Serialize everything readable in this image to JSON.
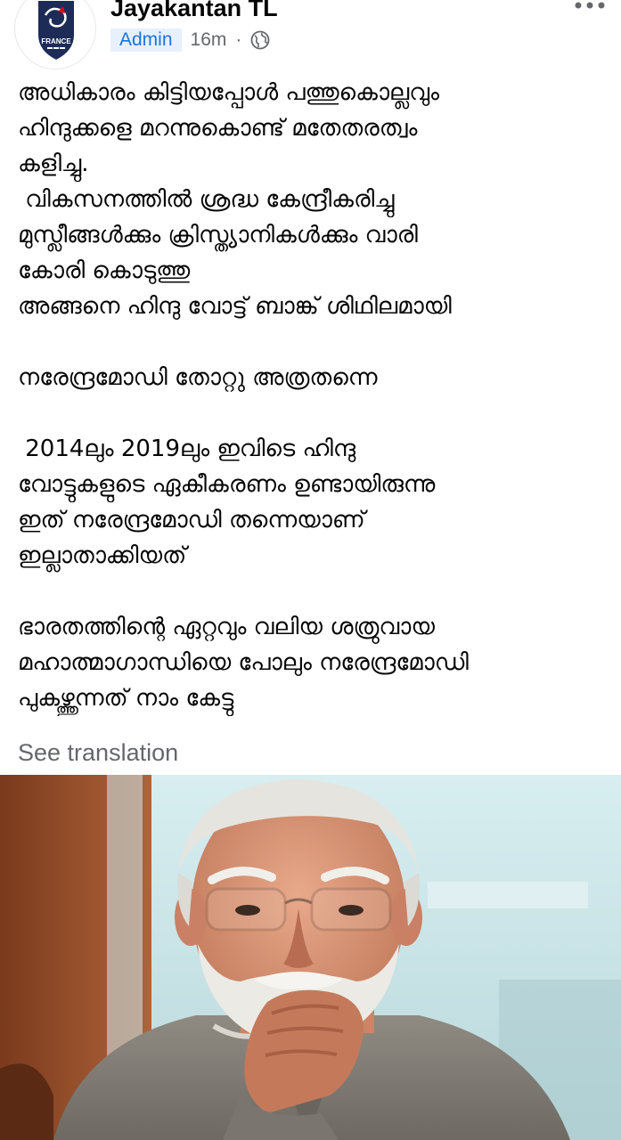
{
  "post": {
    "author_name": "Jayakantan TL",
    "badge": "Admin",
    "time": "16m",
    "separator": "·",
    "privacy_icon": "globe-icon",
    "avatar_logo_text": "FRANCE",
    "text_lines": [
      "അധികാരം കിട്ടിയപ്പോൾ പത്തുകൊല്ലവും",
      "ഹിന്ദുക്കളെ മറന്നുകൊണ്ട് മതേതരത്വം",
      "കളിച്ചു.",
      " വികസനത്തിൽ ശ്രദ്ധ കേന്ദ്രീകരിച്ചു",
      "മുസ്ലീങ്ങൾക്കും ക്രിസ്ത്യാനികൾക്കും വാരി",
      "കോരി കൊടുത്തു",
      "അങ്ങനെ ഹിന്ദു വോട്ട് ബാങ്ക് ശിഥിലമായി",
      "",
      "നരേന്ദ്രമോഡി തോറ്റു അത്രതന്നെ",
      "",
      " 2014ലും 2019ലും ഇവിടെ ഹിന്ദു",
      "വോട്ടുകളുടെ ഏകീകരണം ഉണ്ടായിരുന്നു",
      "ഇത് നരേന്ദ്രമോഡി തന്നെയാണ്",
      "ഇല്ലാതാക്കിയത്",
      "",
      "ഭാരതത്തിന്റെ ഏറ്റവും വലിയ ശത്രുവായ",
      "മഹാത്മാഗാന്ധിയെ പോലും നരേന്ദ്രമോഡി",
      "പുകഴ്ത്തുന്നത് നാം കേട്ടു"
    ],
    "see_translation": "See translation"
  },
  "colors": {
    "badge_text": "#1b74e4",
    "badge_bg": "#e7f0fd",
    "secondary_text": "#65676b",
    "primary_text": "#050505"
  }
}
